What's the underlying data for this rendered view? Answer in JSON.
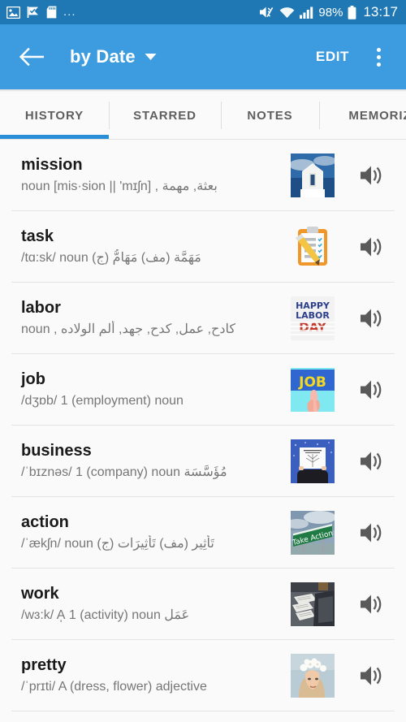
{
  "status_bar": {
    "icons": [
      "image-icon",
      "flag-check-icon",
      "sd-card-icon"
    ],
    "more_dots": "...",
    "mute_icon": "mute-icon",
    "wifi_icon": "wifi-icon",
    "signal_icon": "signal-bars-icon",
    "battery_percent": "98%",
    "battery_icon": "battery-icon",
    "clock": "13:17",
    "background": "#1f78b4"
  },
  "app_bar": {
    "back_icon": "back-arrow-icon",
    "title": "by Date",
    "dropdown_icon": "chevron-down-icon",
    "edit_label": "EDIT",
    "overflow_icon": "overflow-menu-icon",
    "background": "#3d9ce0"
  },
  "tabs": {
    "active_index": 0,
    "indicator_color": "#2b8fd8",
    "items": [
      {
        "label": "HISTORY"
      },
      {
        "label": "STARRED"
      },
      {
        "label": "NOTES"
      },
      {
        "label": "MEMORIZ"
      }
    ]
  },
  "list": {
    "items": [
      {
        "word": "mission",
        "gloss": "noun [mis·sion || 'mɪʃn] , بعثة, مهمة",
        "thumb": "white-chapel-photo",
        "audio_icon": "speaker-icon"
      },
      {
        "word": "task",
        "gloss": "/tɑ:sk/ noun  مَهَمَّة (مف) مَهَامُّ (ج)",
        "thumb": "clipboard-checklist-icon",
        "audio_icon": "speaker-icon"
      },
      {
        "word": "labor",
        "gloss": "noun , كادح, عمل, كدح, جهد, ألم الولاده",
        "thumb": "happy-labor-day-graphic",
        "audio_icon": "speaker-icon"
      },
      {
        "word": "job",
        "gloss": "/dʒɒb/ 1 (employment) noun",
        "thumb": "job-sign-hand-graphic",
        "audio_icon": "speaker-icon"
      },
      {
        "word": "business",
        "gloss": "/ˈbɪznəs/ 1 (company) noun  مُؤَسَّسَة",
        "thumb": "business-chart-photo",
        "audio_icon": "speaker-icon"
      },
      {
        "word": "action",
        "gloss": "/ˈækʃn/ noun  تَأثِير (مف) تَأثِيرَات (ج)",
        "thumb": "take-action-road-sign-photo",
        "audio_icon": "speaker-icon"
      },
      {
        "word": "work",
        "gloss": "/wɜ:k/ A̩ 1 (activity) noun  عَمَل",
        "thumb": "desk-papers-photo",
        "audio_icon": "speaker-icon"
      },
      {
        "word": "pretty",
        "gloss": "/ˈprɪti/ A (dress, flower) adjective",
        "thumb": "woman-flower-crown-photo",
        "audio_icon": "speaker-icon"
      }
    ]
  }
}
